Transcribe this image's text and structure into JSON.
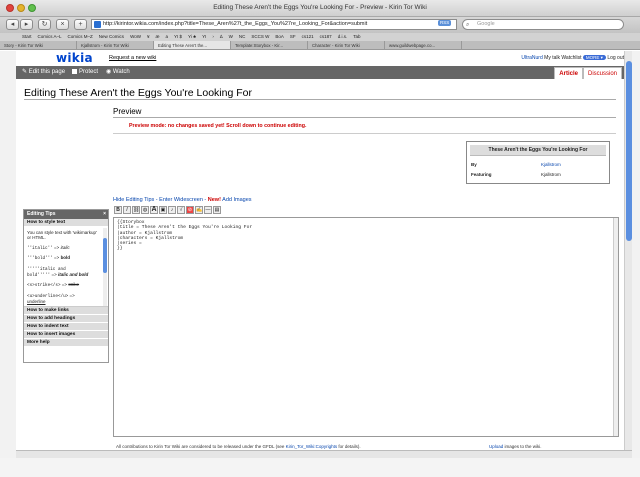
{
  "window": {
    "title": "Editing These Aren't the Eggs You're Looking For - Preview - Kirin Tor Wiki"
  },
  "browser": {
    "url": "http://kirintor.wikia.com/index.php?title=These_Aren%27t_the_Eggs_You%27re_Looking_For&action=submit",
    "rss_label": "RSS",
    "search_placeholder": "Google",
    "bookmarks": [
      "Start",
      "Comics A–L",
      "Comics M–Z",
      "New Comics",
      "WoW",
      "¥",
      "æ",
      "a",
      "YI $",
      "Yi ♣",
      "YI",
      "›",
      "∆",
      "W",
      "NC",
      "SCCS W",
      "BoA",
      "SF",
      "cs121",
      "cs187",
      "d.i.s.",
      "Tab"
    ],
    "tabs": [
      "Story - Kirin Tor Wiki",
      "Kjallstrom - Kirin Tor Wiki",
      "Editing These Aren't the...",
      "Template:Storybox - Kir...",
      "Character - Kirin Tor Wiki",
      "www.guildwebpage.co..."
    ]
  },
  "wikia": {
    "logo": "wikia",
    "request_link": "Request a new wiki",
    "username": "UltraNurd",
    "mytalk": "My talk",
    "watchlist": "Watchlist",
    "more": "MORE",
    "logout": "Log out"
  },
  "actions": {
    "edit": "Edit this page",
    "protect": "Protect",
    "watch": "Watch",
    "article_tab": "Article",
    "discussion_tab": "Discussion"
  },
  "page": {
    "title": "Editing These Aren't the Eggs You're Looking For",
    "preview_heading": "Preview",
    "warning": "Preview mode: no changes saved yet! Scroll down to continue editing."
  },
  "infobox": {
    "title": "These Aren't the Eggs You're Looking For",
    "rows": [
      {
        "key": "By",
        "value": "Kjallstrom"
      },
      {
        "key": "Featuring",
        "value": "Kjallstrom"
      }
    ]
  },
  "editor": {
    "links": {
      "hide_tips": "Hide Editing Tips",
      "sep1": " - ",
      "widescreen": "Enter Widescreen",
      "sep2": " - ",
      "new_label": "New!",
      "add_images": " Add Images"
    },
    "lines": [
      "{{Storybox",
      "|title = These Aren't the Eggs You're Looking For",
      "|author = Kjallstrom",
      "|characters = Kjallstrom",
      "|series =",
      "}}"
    ]
  },
  "tips": {
    "header": "Editing Tips",
    "close": "×",
    "active_section": "How to style text",
    "body": {
      "intro": "You can style text with 'wikimarkup' or HTML.",
      "italic_code": "''italic''",
      "italic_result": "italic",
      "bold_code": "'''bold'''",
      "bold_result": "bold",
      "bi_code1": "'''''italic and",
      "bi_code2": "bold'''''",
      "bi_result": "italic and bold",
      "strike_code": "<s>strike</s>",
      "strike_result": "strike",
      "underline_code": "<u>underline</u>",
      "underline_result": "underline",
      "arrow": " => "
    },
    "sections": [
      "How to make links",
      "How to add headings",
      "How to indent text",
      "How to insert images",
      "More help"
    ]
  },
  "footer": {
    "left_text": "All contributions to Kirin Tor Wiki are considered to be released under the GFDL (see ",
    "left_link": "Kirin_Tor_Wiki:Copyrights",
    "left_tail": " for details).",
    "right_link": "Upload",
    "right_text": " images to the wiki."
  }
}
